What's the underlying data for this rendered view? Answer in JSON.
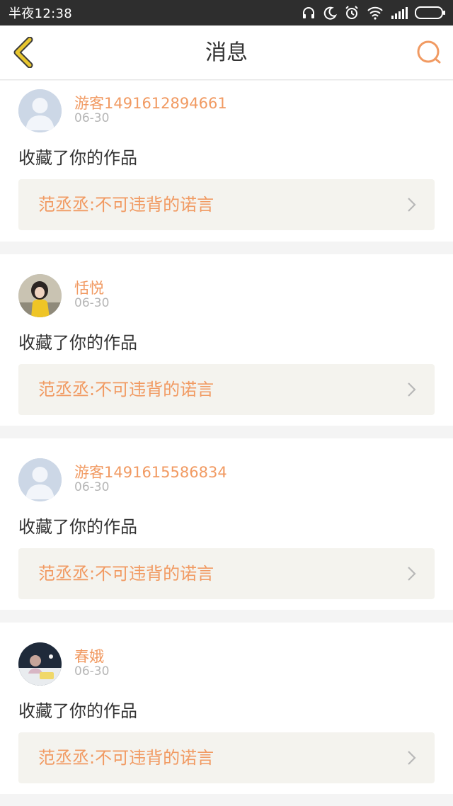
{
  "status_bar": {
    "time": "半夜12:38",
    "icons": [
      "headphones-icon",
      "moon-icon",
      "alarm-icon",
      "wifi-icon",
      "signal-icon",
      "battery-icon"
    ]
  },
  "header": {
    "title": "消息",
    "back_icon": "chevron-left-icon",
    "search_icon": "search-icon"
  },
  "colors": {
    "accent": "#f19a62",
    "back_arrow": "#e8c62e",
    "status_bar_bg": "#2e2e2e"
  },
  "messages": [
    {
      "username": "游客1491612894661",
      "date": "06-30",
      "action": "收藏了你的作品",
      "work_title": "范丞丞:不可违背的诺言",
      "avatar": "default-avatar"
    },
    {
      "username": "恬悦",
      "date": "06-30",
      "action": "收藏了你的作品",
      "work_title": "范丞丞:不可违背的诺言",
      "avatar": "photo-avatar"
    },
    {
      "username": "游客1491615586834",
      "date": "06-30",
      "action": "收藏了你的作品",
      "work_title": "范丞丞:不可违背的诺言",
      "avatar": "default-avatar"
    },
    {
      "username": "春娥",
      "date": "06-30",
      "action": "收藏了你的作品",
      "work_title": "范丞丞:不可违背的诺言",
      "avatar": "photo-avatar"
    }
  ]
}
